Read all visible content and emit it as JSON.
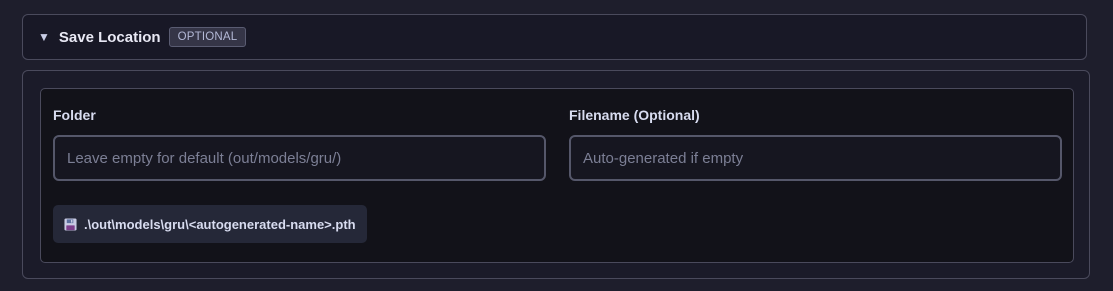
{
  "section": {
    "title": "Save Location",
    "badge": "OPTIONAL",
    "caret_icon": "triangle-down"
  },
  "folder": {
    "label": "Folder",
    "value": "",
    "placeholder": "Leave empty for default (out/models/gru/)"
  },
  "filename": {
    "label": "Filename (Optional)",
    "value": "",
    "placeholder": "Auto-generated if empty"
  },
  "preview": {
    "icon": "floppy-disk-icon",
    "path": ".\\out\\models\\gru\\<autogenerated-name>.pth"
  },
  "colors": {
    "background": "#1e1e2c",
    "card": "#121219",
    "border": "#4a4a5c",
    "text": "#e4e4f0",
    "placeholder": "#7c7f95",
    "chip": "#252838"
  }
}
